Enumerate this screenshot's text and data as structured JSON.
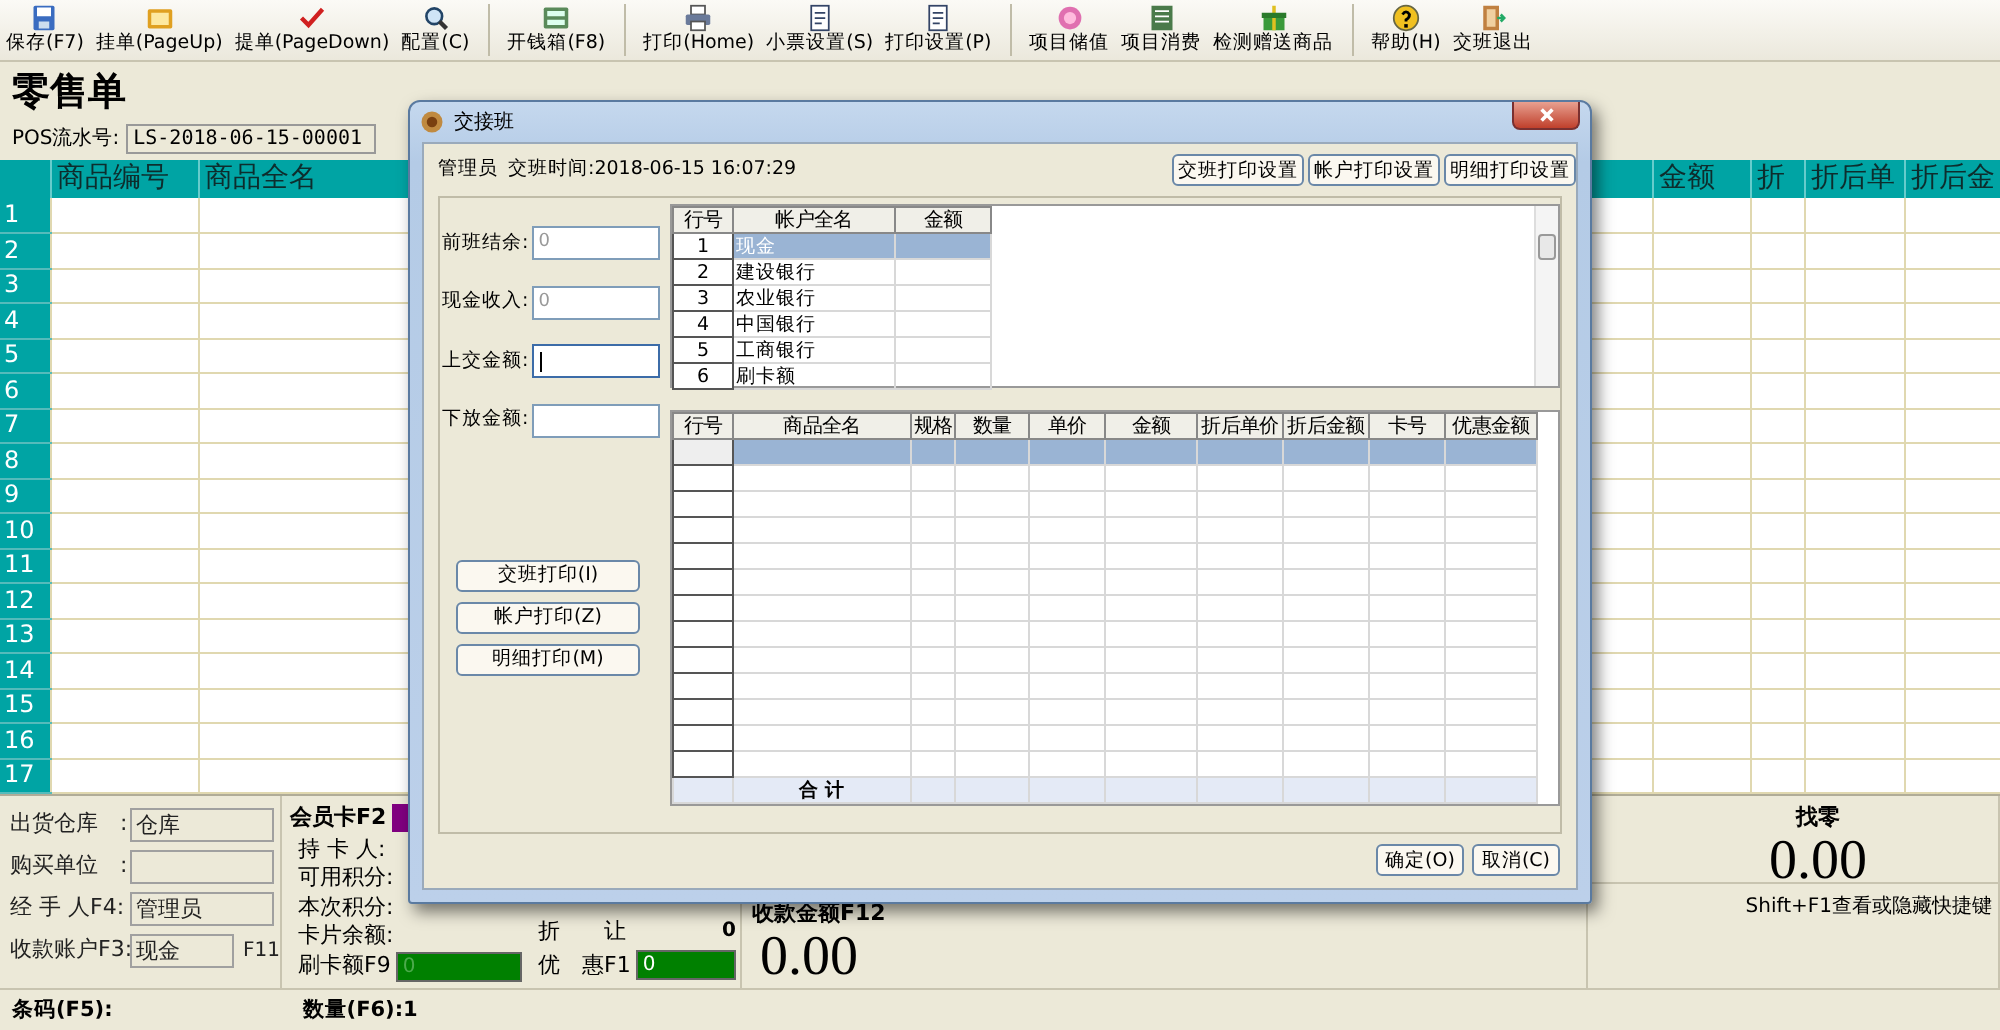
{
  "toolbar": {
    "groups": [
      [
        {
          "label": "保存(F7)"
        },
        {
          "label": "挂单(PageUp)"
        },
        {
          "label": "提单(PageDown)"
        },
        {
          "label": "配置(C)"
        }
      ],
      [
        {
          "label": "开钱箱(F8)"
        }
      ],
      [
        {
          "label": "打印(Home)"
        },
        {
          "label": "小票设置(S)"
        },
        {
          "label": "打印设置(P)"
        }
      ],
      [
        {
          "label": "项目储值"
        },
        {
          "label": "项目消费"
        },
        {
          "label": "检测赠送商品"
        }
      ],
      [
        {
          "label": "帮助(H)"
        },
        {
          "label": "交班退出"
        }
      ]
    ]
  },
  "title": "零售单",
  "pos_serial": {
    "label": "POS流水号:",
    "value": "LS-2018-06-15-00001"
  },
  "grid": {
    "columns": [
      "商品编号",
      "商品全名",
      "金额",
      "折",
      "折后单",
      "折后金"
    ],
    "row_numbers": [
      "1",
      "2",
      "3",
      "4",
      "5",
      "6",
      "7",
      "8",
      "9",
      "10",
      "11",
      "12",
      "13",
      "14",
      "15",
      "16",
      "17"
    ]
  },
  "order_fields": [
    {
      "label": "出货仓库　:",
      "value": "仓库"
    },
    {
      "label": "购买单位　:"
    },
    {
      "label": "经 手 人F4:",
      "value": "管理员"
    },
    {
      "label": "收款账户F3:",
      "value": "现金",
      "shortcut": "F11"
    }
  ],
  "member": {
    "title": "会员卡F2",
    "lines": [
      "持 卡 人:",
      "可用积分:",
      "本次积分:",
      "卡片余额:"
    ],
    "swipe": {
      "label": "刷卡额F9",
      "value": "0",
      "disabled": true
    }
  },
  "discount": {
    "label": "折　　让",
    "value": "0"
  },
  "promo": {
    "label": "优　惠F1",
    "value": "0",
    "disabled": false
  },
  "receipt": {
    "label": "收款金额F12",
    "amount": "0.00"
  },
  "change": {
    "label": "找零",
    "amount": "0.00"
  },
  "shortcut_hint": "Shift+F1查看或隐藏快捷键",
  "status_bar": [
    {
      "label": "条码(F5):"
    },
    {
      "label": "数量(F6):",
      "value": "1"
    }
  ],
  "dialog": {
    "title": "交接班",
    "operator": "管理员",
    "shift_time": "交班时间:2018-06-15 16:07:29",
    "setting_buttons": [
      "交班打印设置",
      "帐户打印设置",
      "明细打印设置"
    ],
    "fields": [
      {
        "label": "前班结余:",
        "placeholder": "0",
        "focused": false
      },
      {
        "label": "现金收入:",
        "placeholder": "0",
        "focused": false
      },
      {
        "label": "上交金额:",
        "focused": true
      },
      {
        "label": "下放金额:",
        "focused": false
      }
    ],
    "print_buttons": [
      "交班打印(I)",
      "帐户打印(Z)",
      "明细打印(M)"
    ],
    "accounts": {
      "columns": [
        "行号",
        "帐户全名",
        "金额"
      ],
      "rows": [
        {
          "no": "1",
          "name": "现金",
          "selected": true
        },
        {
          "no": "2",
          "name": "建设银行",
          "selected": false
        },
        {
          "no": "3",
          "name": "农业银行",
          "selected": false
        },
        {
          "no": "4",
          "name": "中国银行",
          "selected": false
        },
        {
          "no": "5",
          "name": "工商银行",
          "selected": false
        },
        {
          "no": "6",
          "name": "刷卡额",
          "selected": false
        }
      ]
    },
    "details": {
      "columns": [
        "行号",
        "商品全名",
        "规格",
        "数量",
        "单价",
        "金额",
        "折后单价",
        "折后金额",
        "卡号",
        "优惠金额"
      ],
      "rows": [
        {
          "selected": true
        },
        {
          "selected": false
        },
        {
          "selected": false
        },
        {
          "selected": false
        },
        {
          "selected": false
        },
        {
          "selected": false
        },
        {
          "selected": false
        },
        {
          "selected": false
        },
        {
          "selected": false
        },
        {
          "selected": false
        },
        {
          "selected": false
        },
        {
          "selected": false
        },
        {
          "selected": false
        }
      ],
      "total_label": "合 计"
    },
    "footer_buttons": [
      "确定(O)",
      "取消(C)"
    ]
  }
}
